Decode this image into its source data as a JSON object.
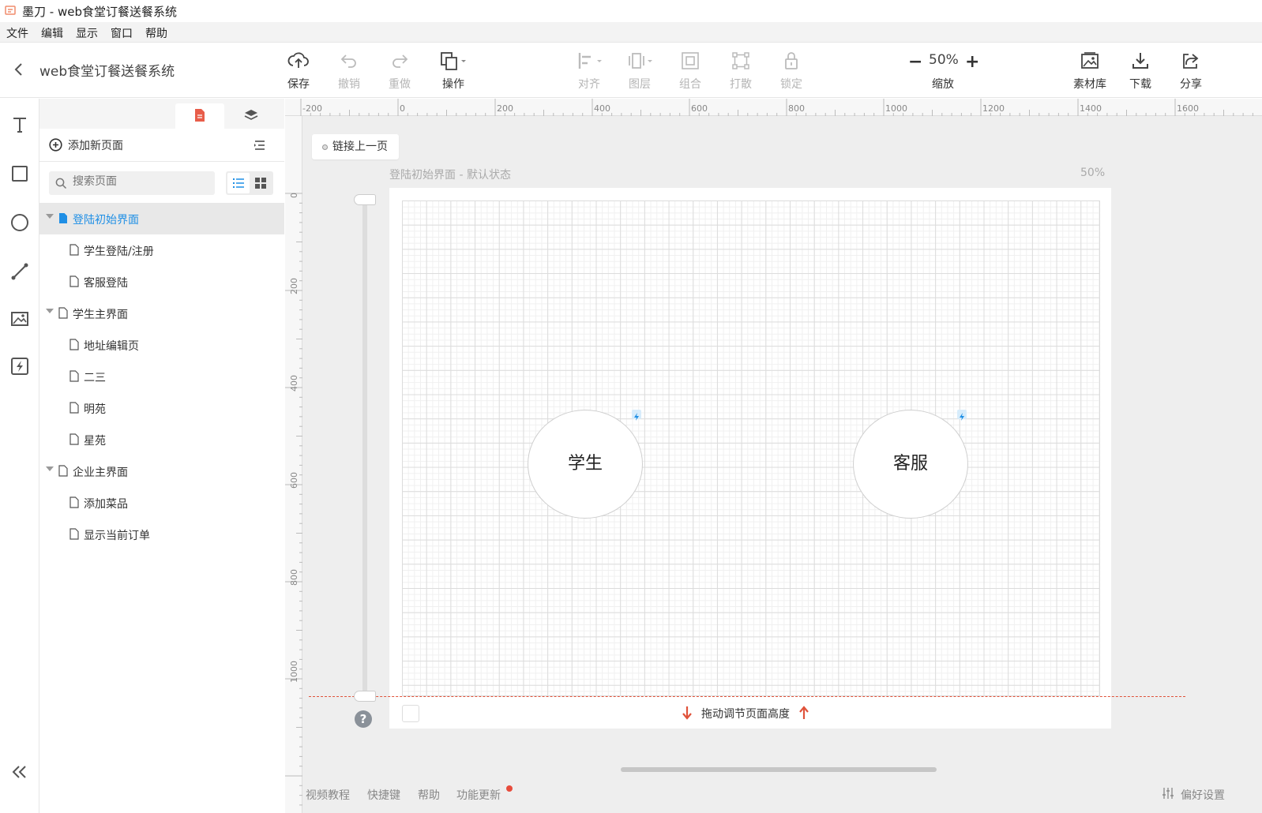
{
  "window": {
    "title": "墨刀 - web食堂订餐送餐系统"
  },
  "menu": [
    "文件",
    "编辑",
    "显示",
    "窗口",
    "帮助"
  ],
  "toolbar": {
    "project_name": "web食堂订餐送餐系统",
    "save": "保存",
    "undo": "撤销",
    "redo": "重做",
    "operate": "操作",
    "align": "对齐",
    "layer": "图层",
    "group": "组合",
    "ungroup": "打散",
    "lock": "锁定",
    "zoom_minus": "−",
    "zoom_value": "50%",
    "zoom_plus": "+",
    "zoom_label": "缩放",
    "assets": "素材库",
    "download": "下载",
    "share": "分享"
  },
  "panel": {
    "add_page": "添加新页面",
    "search_placeholder": "搜索页面",
    "pages": [
      {
        "label": "登陆初始界面",
        "level": 0,
        "selected": true
      },
      {
        "label": "学生登陆/注册",
        "level": 1
      },
      {
        "label": "客服登陆",
        "level": 1
      },
      {
        "label": "学生主界面",
        "level": 0
      },
      {
        "label": "地址编辑页",
        "level": 1
      },
      {
        "label": "二三",
        "level": 1
      },
      {
        "label": "明苑",
        "level": 1
      },
      {
        "label": "星苑",
        "level": 1
      },
      {
        "label": "企业主界面",
        "level": 0
      },
      {
        "label": "添加菜品",
        "level": 1
      },
      {
        "label": "显示当前订单",
        "level": 1
      }
    ]
  },
  "canvas": {
    "link_prev": "链接上一页",
    "page_caption": "登陆初始界面 - 默认状态",
    "page_zoom": "50%",
    "hruler": [
      "-200",
      "0",
      "200",
      "400",
      "600",
      "800",
      "1000",
      "1200",
      "1400",
      "1600"
    ],
    "vruler": [
      "0",
      "200",
      "400",
      "600",
      "800",
      "1000"
    ],
    "student_button": "学生",
    "service_button": "客服",
    "drag_hint": "拖动调节页面高度"
  },
  "footer": {
    "video": "视频教程",
    "shortcuts": "快捷键",
    "help": "帮助",
    "updates": "功能更新",
    "preferences": "偏好设置"
  },
  "colors": {
    "accent": "#1f8fe5",
    "warn": "#e0523a"
  }
}
